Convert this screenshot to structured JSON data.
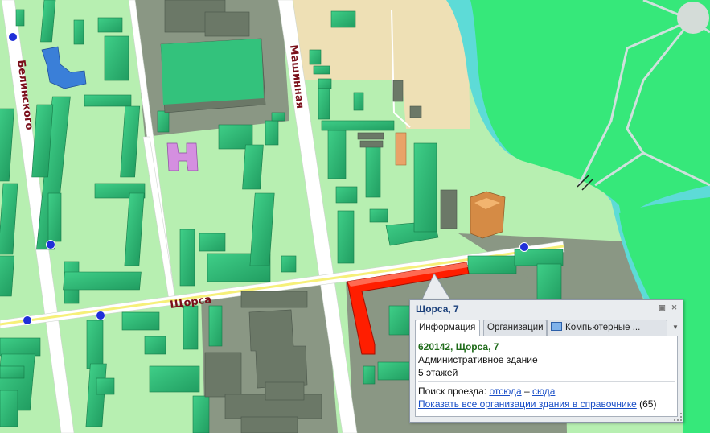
{
  "map": {
    "streets": {
      "shchorsa": "Щорса",
      "belinskogo": "Белинского",
      "mashinnaya": "Машинная"
    },
    "colors": {
      "land": "#b7efb1",
      "block": "#8a9784",
      "sand": "#eee0b5",
      "water": "#5ddbd7",
      "park": "#36e87a",
      "road": "#ffffff",
      "road_main": "#f6f07a",
      "building": "#2fb676",
      "selected": "#ff1e00"
    }
  },
  "popup": {
    "title": "Щорса, 7",
    "tabs": [
      "Информация",
      "Организации",
      "Компьютерные ..."
    ],
    "address": "620142, Щорса, 7",
    "building_type": "Административное здание",
    "floors": "5 этажей",
    "route_label": "Поиск проезда:",
    "route_from": "отсюда",
    "route_dash": "–",
    "route_to": "сюда",
    "show_all_link": "Показать все организации здания в справочнике",
    "org_count": "(65)"
  }
}
